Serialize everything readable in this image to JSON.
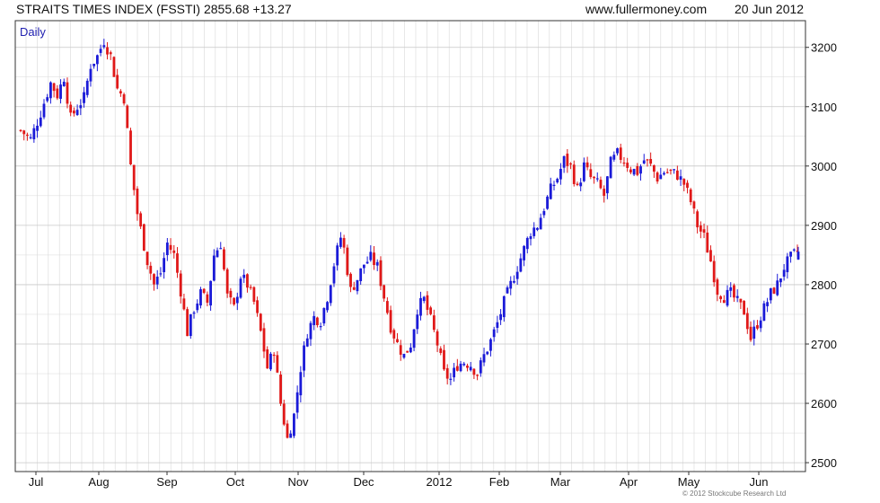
{
  "header": {
    "title": "STRAITS TIMES INDEX (FSSTI) 2855.68 +13.27",
    "site": "www.fullermoney.com",
    "date": "20 Jun 2012"
  },
  "footer": {
    "copyright": "© 2012 Stockcube Research Ltd"
  },
  "colors": {
    "up": "#1a1ad8",
    "down": "#e01818",
    "grid": "#d8d8d8",
    "frame": "#333333"
  },
  "chart_data": {
    "type": "candlestick",
    "period_label": "Daily",
    "x_tick_labels": [
      "Jul",
      "Aug",
      "Sep",
      "Oct",
      "Nov",
      "Dec",
      "2012",
      "Feb",
      "Mar",
      "Apr",
      "May",
      "Jun"
    ],
    "y_tick_labels": [
      2500,
      2600,
      2700,
      2800,
      2900,
      3000,
      3100,
      3200
    ],
    "ylim": [
      2485,
      3245
    ],
    "grid": true,
    "close_path": [
      [
        0,
        3060
      ],
      [
        3,
        3045
      ],
      [
        6,
        3090
      ],
      [
        9,
        3140
      ],
      [
        11,
        3120
      ],
      [
        13,
        3150
      ],
      [
        15,
        3080
      ],
      [
        17,
        3100
      ],
      [
        19,
        3115
      ],
      [
        21,
        3170
      ],
      [
        23,
        3185
      ],
      [
        25,
        3212
      ],
      [
        27,
        3185
      ],
      [
        29,
        3130
      ],
      [
        31,
        3115
      ],
      [
        33,
        3000
      ],
      [
        35,
        2920
      ],
      [
        38,
        2840
      ],
      [
        40,
        2800
      ],
      [
        42,
        2820
      ],
      [
        44,
        2870
      ],
      [
        46,
        2850
      ],
      [
        48,
        2790
      ],
      [
        50,
        2720
      ],
      [
        52,
        2760
      ],
      [
        54,
        2785
      ],
      [
        56,
        2770
      ],
      [
        58,
        2850
      ],
      [
        60,
        2870
      ],
      [
        62,
        2780
      ],
      [
        64,
        2760
      ],
      [
        66,
        2815
      ],
      [
        68,
        2800
      ],
      [
        70,
        2770
      ],
      [
        72,
        2720
      ],
      [
        74,
        2660
      ],
      [
        76,
        2690
      ],
      [
        78,
        2600
      ],
      [
        80,
        2540
      ],
      [
        82,
        2580
      ],
      [
        84,
        2660
      ],
      [
        86,
        2720
      ],
      [
        88,
        2745
      ],
      [
        90,
        2740
      ],
      [
        92,
        2780
      ],
      [
        94,
        2835
      ],
      [
        96,
        2880
      ],
      [
        97,
        2860
      ],
      [
        99,
        2790
      ],
      [
        101,
        2810
      ],
      [
        103,
        2835
      ],
      [
        105,
        2845
      ],
      [
        107,
        2830
      ],
      [
        109,
        2780
      ],
      [
        111,
        2730
      ],
      [
        113,
        2700
      ],
      [
        115,
        2680
      ],
      [
        117,
        2700
      ],
      [
        119,
        2760
      ],
      [
        121,
        2775
      ],
      [
        123,
        2740
      ],
      [
        125,
        2700
      ],
      [
        127,
        2650
      ],
      [
        129,
        2640
      ],
      [
        131,
        2665
      ],
      [
        133,
        2670
      ],
      [
        135,
        2665
      ],
      [
        137,
        2650
      ],
      [
        139,
        2680
      ],
      [
        141,
        2705
      ],
      [
        143,
        2735
      ],
      [
        145,
        2770
      ],
      [
        147,
        2800
      ],
      [
        149,
        2830
      ],
      [
        151,
        2860
      ],
      [
        153,
        2890
      ],
      [
        155,
        2900
      ],
      [
        157,
        2930
      ],
      [
        159,
        2960
      ],
      [
        161,
        2980
      ],
      [
        163,
        3010
      ],
      [
        165,
        3000
      ],
      [
        167,
        2960
      ],
      [
        169,
        3000
      ],
      [
        171,
        2980
      ],
      [
        173,
        2970
      ],
      [
        175,
        2950
      ],
      [
        177,
        3005
      ],
      [
        179,
        3020
      ],
      [
        181,
        3010
      ],
      [
        183,
        2995
      ],
      [
        185,
        2990
      ],
      [
        187,
        3010
      ],
      [
        189,
        3000
      ],
      [
        191,
        2980
      ],
      [
        193,
        2990
      ],
      [
        195,
        2990
      ],
      [
        197,
        2985
      ],
      [
        199,
        2970
      ],
      [
        201,
        2940
      ],
      [
        203,
        2900
      ],
      [
        205,
        2880
      ],
      [
        207,
        2840
      ],
      [
        209,
        2790
      ],
      [
        211,
        2780
      ],
      [
        213,
        2785
      ],
      [
        215,
        2770
      ],
      [
        217,
        2755
      ],
      [
        219,
        2710
      ],
      [
        221,
        2735
      ],
      [
        223,
        2760
      ],
      [
        225,
        2785
      ],
      [
        227,
        2800
      ],
      [
        229,
        2830
      ],
      [
        231,
        2845
      ],
      [
        233,
        2856
      ]
    ],
    "last_value": 2855.68,
    "change": 13.27
  }
}
